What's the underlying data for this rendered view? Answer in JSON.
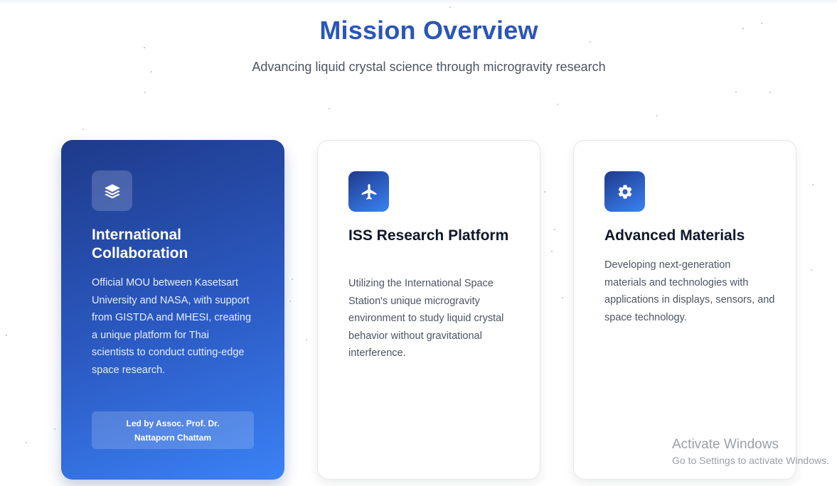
{
  "header": {
    "title": "Mission Overview",
    "subtitle": "Advancing liquid crystal science through microgravity research"
  },
  "cards": [
    {
      "icon": "layers-icon",
      "title": "International Collaboration",
      "text": "Official MOU between Kasetsart University and NASA, with support from GISTDA and MHESI, creating a unique platform for Thai scientists to conduct cutting-edge space research.",
      "lead": "Led by Assoc. Prof. Dr. Nattaporn Chattam"
    },
    {
      "icon": "plane-icon",
      "title": "ISS Research Platform",
      "text": "Utilizing the International Space Station's unique microgravity environment to study liquid crystal behavior without gravitational interference."
    },
    {
      "icon": "gear-icon",
      "title": "Advanced Materials",
      "text": "Developing next-generation materials and technologies with applications in displays, sensors, and space technology."
    }
  ],
  "watermark": {
    "title": "Activate Windows",
    "subtitle": "Go to Settings to activate Windows."
  },
  "colors": {
    "accent": "#2a56b8",
    "featured_start": "#1e3a8a",
    "featured_end": "#3b82f6"
  }
}
